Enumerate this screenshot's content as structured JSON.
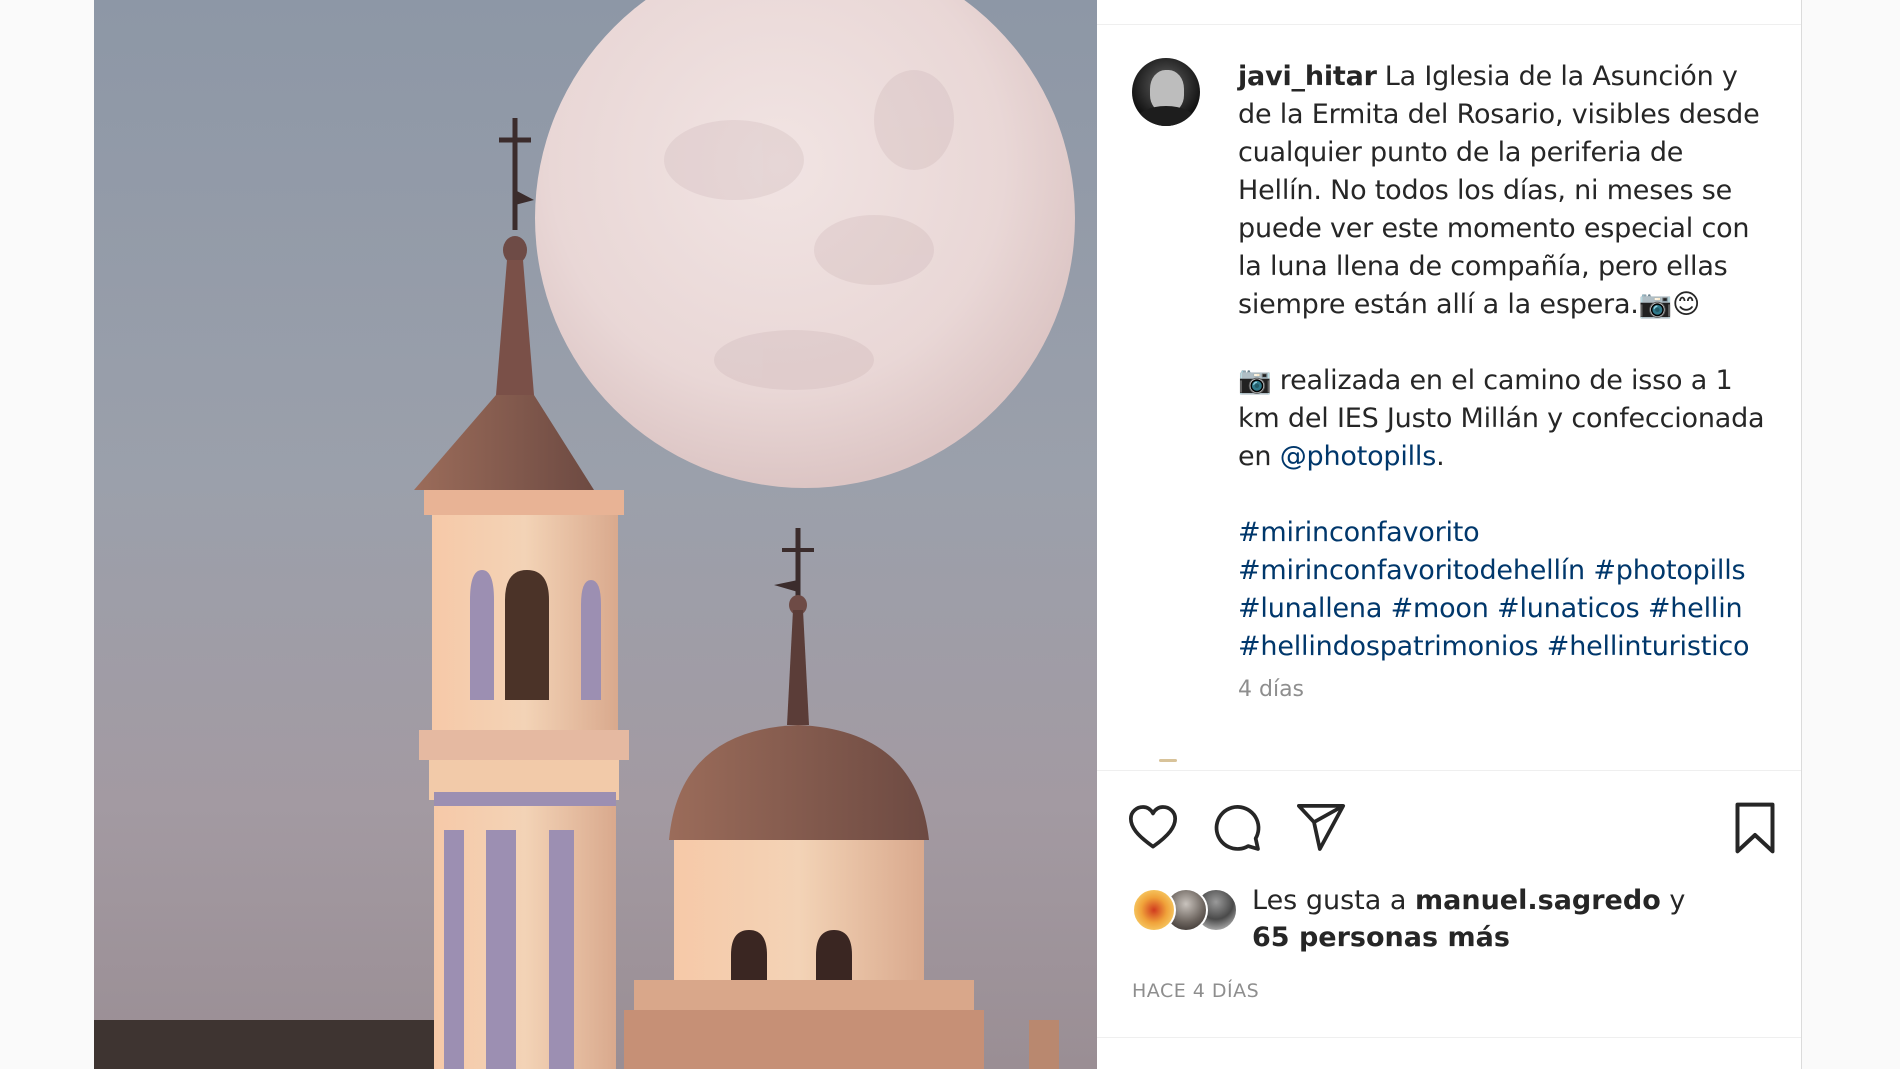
{
  "post": {
    "username": "javi_hitar",
    "caption_lines": [
      "La Iglesia de la Asunción y de la Ermita del Rosario, visibles desde cualquier punto de la periferia de Hellín. No todos los días, ni meses se puede ver este momento especial con la luna llena de compañía, pero ellas siempre están allí a la espera.📷😊"
    ],
    "caption2_prefix": "📷 realizada en el camino de isso a 1 km del IES Justo Millán y confeccionada en ",
    "caption2_mention": "@photopills",
    "caption2_suffix": ".",
    "hashtags": [
      "#mirinconfavorito",
      "#mirinconfavoritodehellín",
      "#photopills",
      "#lunallena",
      "#moon",
      "#lunaticos",
      "#hellin",
      "#hellindospatrimonios",
      "#hellinturistico"
    ],
    "comment_time": "4 días",
    "likes_prefix": "Les gusta a",
    "likes_user": "manuel.sagredo",
    "likes_and": "y",
    "likes_others": "65 personas más",
    "posted_ago": "HACE 4 DÍAS"
  },
  "icons": {
    "like": "heart-icon",
    "comment": "comment-icon",
    "share": "paper-plane-icon",
    "save": "bookmark-icon"
  },
  "colors": {
    "link": "#00376b",
    "muted": "#8e8e8e",
    "text": "#262626"
  }
}
